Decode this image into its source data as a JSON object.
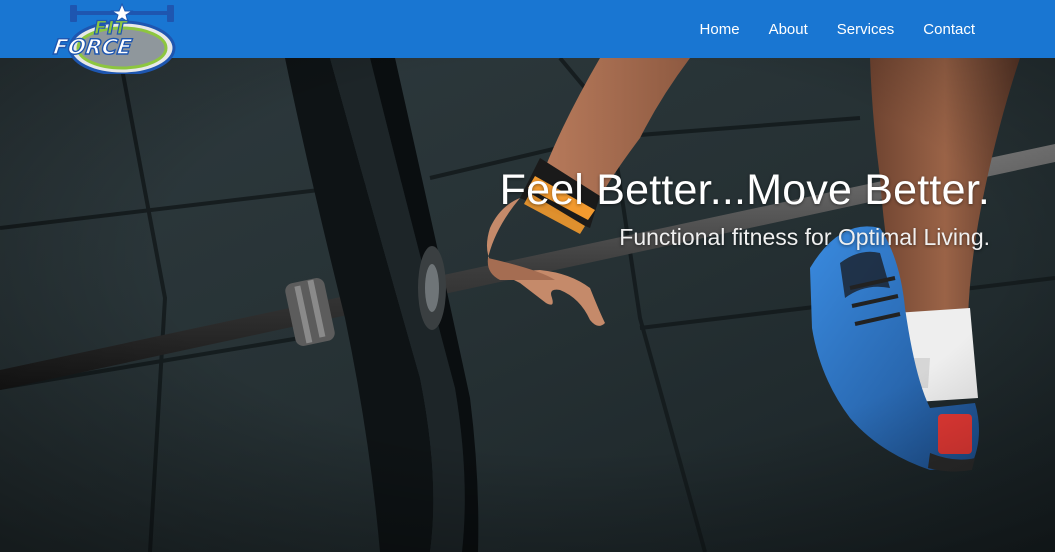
{
  "brand": {
    "logo_line1": "FIT",
    "logo_line2": "FORCE",
    "colors": {
      "header": "#1976d2",
      "logo_green": "#8dc63f",
      "logo_blue": "#1e56b0",
      "accent_orange": "#f39a2e",
      "shoe_blue": "#2f7fd1"
    }
  },
  "nav": {
    "items": [
      {
        "label": "Home"
      },
      {
        "label": "About"
      },
      {
        "label": "Services"
      },
      {
        "label": "Contact"
      }
    ]
  },
  "hero": {
    "title": "Feel Better...Move Better.",
    "subtitle": "Functional fitness for Optimal Living."
  }
}
